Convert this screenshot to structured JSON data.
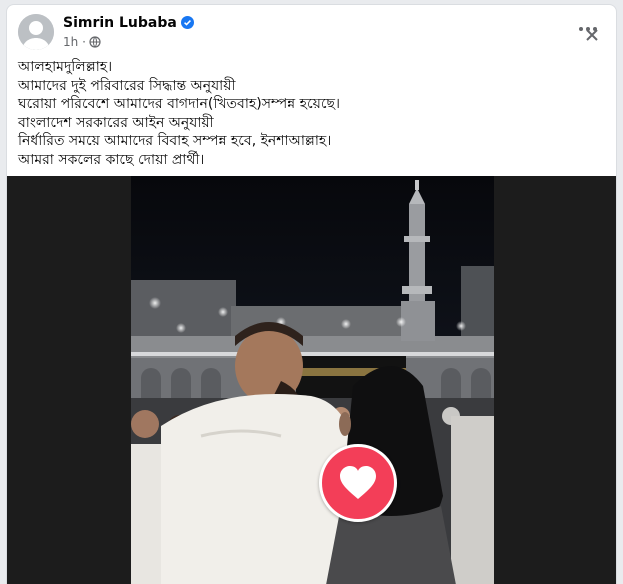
{
  "post": {
    "author": "Simrin Lubaba",
    "verified": true,
    "time": "1h",
    "privacy_icon": "globe-icon",
    "more_icon": "more-dots-icon",
    "close_icon": "close-icon",
    "lines": [
      "আলহামদুলিল্লাহ।",
      "আমাদের দুই পরিবারের সিদ্ধান্ত অনুযায়ী",
      "ঘরোয়া পরিবেশে আমাদের বাগদান(খিতবাহ)সম্পন্ন হয়েছে।",
      "বাংলাদেশ সরকারের আইন অনুযায়ী",
      "নির্ধারিত সময়ে আমাদের বিবাহ সম্পন্ন হবে, ইনশাআল্লাহ।",
      "আমরা সকলের কাছে দোয়া প্রার্থী।"
    ]
  },
  "media": {
    "reaction_icon": "love-heart-icon",
    "colors": {
      "reaction": "#f33e58",
      "verified": "#1877f2",
      "sky": "#0d0f14"
    }
  }
}
